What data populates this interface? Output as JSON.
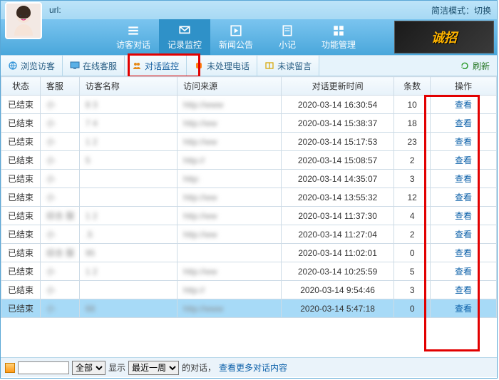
{
  "header": {
    "url_label": "url:",
    "compact_label": "简洁模式：切换"
  },
  "nav": {
    "items": [
      {
        "label": "访客对话",
        "icon": "list"
      },
      {
        "label": "记录监控",
        "icon": "mail",
        "active": true
      },
      {
        "label": "新闻公告",
        "icon": "play"
      },
      {
        "label": "小记",
        "icon": "note"
      },
      {
        "label": "功能管理",
        "icon": "grid"
      }
    ],
    "banner_text": "诚招"
  },
  "tabs": {
    "items": [
      {
        "label": "浏览访客",
        "icon": "globe"
      },
      {
        "label": "在线客服",
        "icon": "monitor"
      },
      {
        "label": "对话监控",
        "icon": "people",
        "selected": true
      },
      {
        "label": "未处理电话",
        "icon": "phone"
      },
      {
        "label": "未读留言",
        "icon": "book"
      }
    ],
    "refresh_label": "刷新"
  },
  "table": {
    "columns": [
      "状态",
      "客服",
      "访客名称",
      "访问来源",
      "对话更新时间",
      "条数",
      "操作"
    ],
    "view_label": "查看",
    "rows": [
      {
        "status": "已结束",
        "cs": "小",
        "name": "8   3",
        "src": "http://www",
        "time": "2020-03-14 16:30:54",
        "cnt": 10
      },
      {
        "status": "已结束",
        "cs": "小",
        "name": "7   4",
        "src": "http://ww",
        "time": "2020-03-14 15:38:37",
        "cnt": 18
      },
      {
        "status": "已结束",
        "cs": "小",
        "name": "1   2",
        "src": "http://ww",
        "time": "2020-03-14 15:17:53",
        "cnt": 23
      },
      {
        "status": "已结束",
        "cs": "小",
        "name": "    5",
        "src": "http://",
        "time": "2020-03-14 15:08:57",
        "cnt": 2
      },
      {
        "status": "已结束",
        "cs": "小",
        "name": "",
        "src": "http:",
        "time": "2020-03-14 14:35:07",
        "cnt": 3
      },
      {
        "status": "已结束",
        "cs": "小",
        "name": "",
        "src": "http://ww",
        "time": "2020-03-14 13:55:32",
        "cnt": 12
      },
      {
        "status": "已结束",
        "cs": "综合  服",
        "name": "1   2",
        "src": "http://ww",
        "time": "2020-03-14 11:37:30",
        "cnt": 4
      },
      {
        "status": "已结束",
        "cs": "小",
        "name": "   .5",
        "src": "http://ww",
        "time": "2020-03-14 11:27:04",
        "cnt": 2
      },
      {
        "status": "已结束",
        "cs": "综合  服",
        "name": "   95",
        "src": "",
        "time": "2020-03-14 11:02:01",
        "cnt": 0
      },
      {
        "status": "已结束",
        "cs": "小",
        "name": "1   2",
        "src": "http://ww",
        "time": "2020-03-14 10:25:59",
        "cnt": 5
      },
      {
        "status": "已结束",
        "cs": "小",
        "name": "",
        "src": "http://",
        "time": "2020-03-14 9:54:46",
        "cnt": 3
      },
      {
        "status": "已结束",
        "cs": "小",
        "name": "68",
        "src": "http://www",
        "time": "2020-03-14 5:47:18",
        "cnt": 0,
        "selected": true
      }
    ]
  },
  "footer": {
    "select_all": "全部",
    "show_label": "显示",
    "period": "最近一周",
    "suffix": "的对话，",
    "more_link": "查看更多对话内容"
  }
}
